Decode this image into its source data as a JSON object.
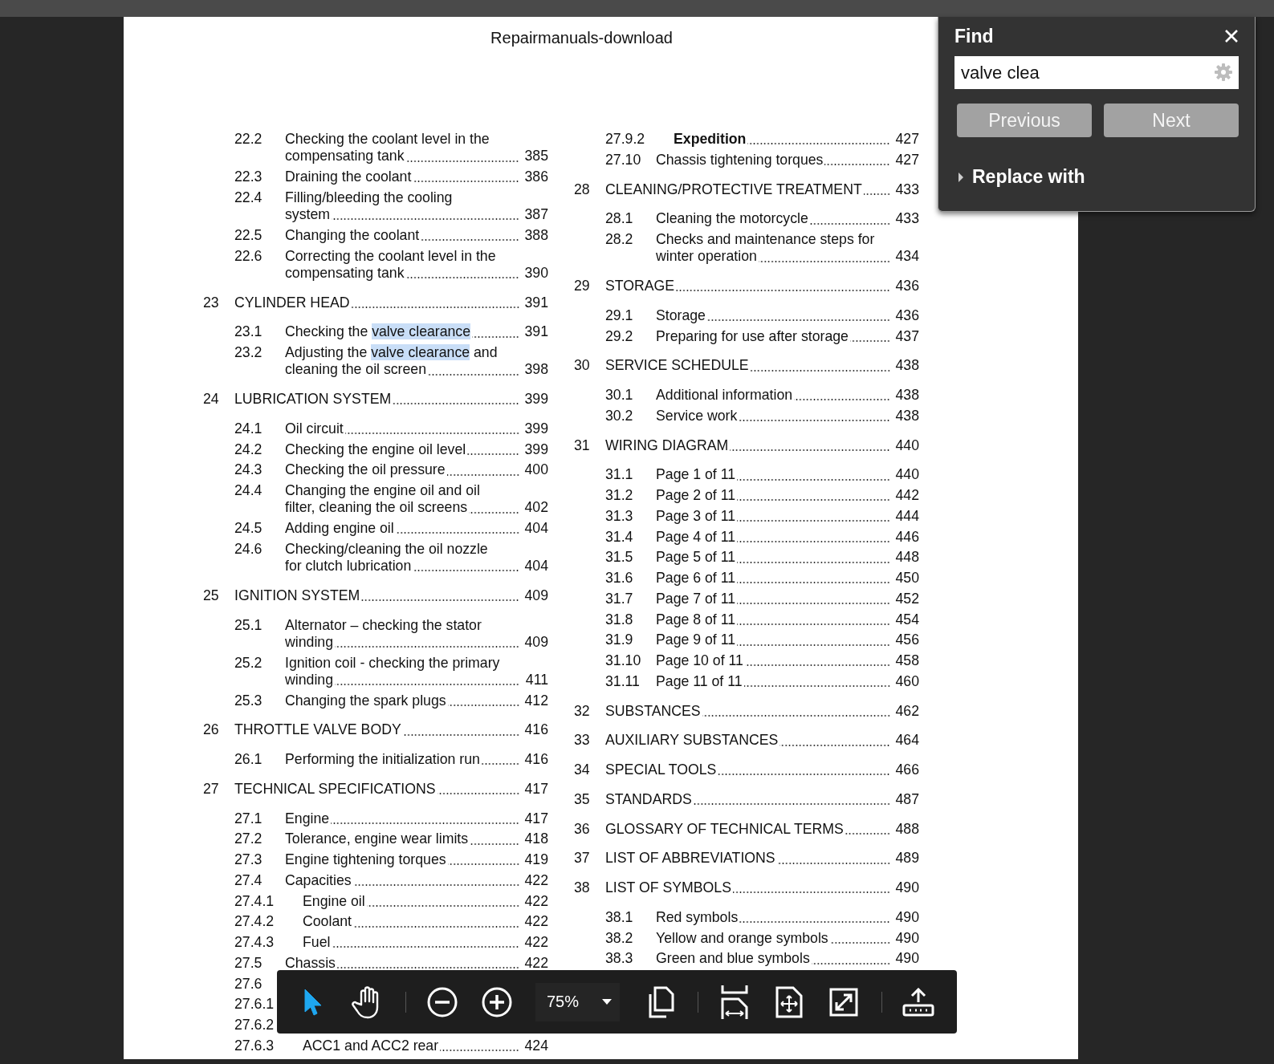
{
  "document": {
    "header": "Repairmanuals-download",
    "columns": [
      {
        "entries": [
          {
            "kind": "section",
            "number": "22.2",
            "lines": [
              "Checking the coolant level in the",
              "compensating tank"
            ],
            "page": "385"
          },
          {
            "kind": "section",
            "number": "22.3",
            "lines": [
              "Draining the coolant"
            ],
            "page": "386"
          },
          {
            "kind": "section",
            "number": "22.4",
            "lines": [
              "Filling/bleeding the cooling",
              "system"
            ],
            "page": "387"
          },
          {
            "kind": "section",
            "number": "22.5",
            "lines": [
              "Changing the coolant"
            ],
            "page": "388"
          },
          {
            "kind": "section",
            "number": "22.6",
            "lines": [
              "Correcting the coolant level in the",
              "compensating tank"
            ],
            "page": "390"
          },
          {
            "kind": "chapter",
            "number": "23",
            "lines": [
              "CYLINDER HEAD"
            ],
            "page": "391"
          },
          {
            "kind": "section",
            "number": "23.1",
            "lines": [
              {
                "segments": [
                  {
                    "text": "Checking the ",
                    "highlighted": false
                  },
                  {
                    "text": "valve clearance",
                    "highlighted": true
                  }
                ]
              }
            ],
            "page": "391"
          },
          {
            "kind": "section",
            "number": "23.2",
            "lines": [
              {
                "segments": [
                  {
                    "text": "Adjusting the ",
                    "highlighted": false
                  },
                  {
                    "text": "valve clearance",
                    "highlighted": true
                  },
                  {
                    "text": " and",
                    "highlighted": false
                  }
                ]
              },
              "cleaning the oil screen"
            ],
            "page": "398"
          },
          {
            "kind": "chapter",
            "number": "24",
            "lines": [
              "LUBRICATION SYSTEM"
            ],
            "page": "399"
          },
          {
            "kind": "section",
            "number": "24.1",
            "lines": [
              "Oil circuit"
            ],
            "page": "399"
          },
          {
            "kind": "section",
            "number": "24.2",
            "lines": [
              "Checking the engine oil level"
            ],
            "page": "399"
          },
          {
            "kind": "section",
            "number": "24.3",
            "lines": [
              "Checking the oil pressure"
            ],
            "page": "400"
          },
          {
            "kind": "section",
            "number": "24.4",
            "lines": [
              "Changing the engine oil and oil",
              "filter, cleaning the oil screens"
            ],
            "page": "402"
          },
          {
            "kind": "section",
            "number": "24.5",
            "lines": [
              "Adding engine oil"
            ],
            "page": "404"
          },
          {
            "kind": "section",
            "number": "24.6",
            "lines": [
              "Checking/cleaning the oil nozzle",
              "for clutch lubrication"
            ],
            "page": "404"
          },
          {
            "kind": "chapter",
            "number": "25",
            "lines": [
              "IGNITION SYSTEM"
            ],
            "page": "409"
          },
          {
            "kind": "section",
            "number": "25.1",
            "lines": [
              "Alternator – checking the stator",
              "winding"
            ],
            "page": "409"
          },
          {
            "kind": "section",
            "number": "25.2",
            "lines": [
              "Ignition coil - checking the primary",
              "winding"
            ],
            "page": "411"
          },
          {
            "kind": "section",
            "number": "25.3",
            "lines": [
              "Changing the spark plugs"
            ],
            "page": "412"
          },
          {
            "kind": "chapter",
            "number": "26",
            "lines": [
              "THROTTLE VALVE BODY"
            ],
            "page": "416"
          },
          {
            "kind": "section",
            "number": "26.1",
            "lines": [
              "Performing the initialization run"
            ],
            "page": "416"
          },
          {
            "kind": "chapter",
            "number": "27",
            "lines": [
              "TECHNICAL SPECIFICATIONS"
            ],
            "page": "417"
          },
          {
            "kind": "section",
            "number": "27.1",
            "lines": [
              "Engine"
            ],
            "page": "417"
          },
          {
            "kind": "section",
            "number": "27.2",
            "lines": [
              "Tolerance, engine wear limits"
            ],
            "page": "418"
          },
          {
            "kind": "section",
            "number": "27.3",
            "lines": [
              "Engine tightening torques"
            ],
            "page": "419"
          },
          {
            "kind": "section",
            "number": "27.4",
            "lines": [
              "Capacities"
            ],
            "page": "422"
          },
          {
            "kind": "subsection",
            "number": "27.4.1",
            "lines": [
              "Engine oil"
            ],
            "page": "422"
          },
          {
            "kind": "subsection",
            "number": "27.4.2",
            "lines": [
              "Coolant"
            ],
            "page": "422"
          },
          {
            "kind": "subsection",
            "number": "27.4.3",
            "lines": [
              "Fuel"
            ],
            "page": "422"
          },
          {
            "kind": "section",
            "number": "27.5",
            "lines": [
              "Chassis"
            ],
            "page": "422"
          },
          {
            "kind": "section",
            "number": "27.6"
          },
          {
            "kind": "subsection",
            "number": "27.6.1"
          },
          {
            "kind": "subsection",
            "number": "27.6.2"
          },
          {
            "kind": "subsection",
            "number": "27.6.3",
            "lines": [
              "ACC1 and ACC2 rear"
            ],
            "page": "424"
          }
        ]
      },
      {
        "entries": [
          {
            "kind": "subsection",
            "number": "27.9.2",
            "lines": [
              "Expedition"
            ],
            "page": "427",
            "bold": true
          },
          {
            "kind": "section",
            "number": "27.10",
            "lines": [
              "Chassis tightening torques"
            ],
            "page": "427"
          },
          {
            "kind": "chapter",
            "number": "28",
            "lines": [
              "CLEANING/PROTECTIVE TREATMENT"
            ],
            "page": "433"
          },
          {
            "kind": "section",
            "number": "28.1",
            "lines": [
              "Cleaning the motorcycle"
            ],
            "page": "433"
          },
          {
            "kind": "section",
            "number": "28.2",
            "lines": [
              "Checks and maintenance steps for",
              "winter operation"
            ],
            "page": "434"
          },
          {
            "kind": "chapter",
            "number": "29",
            "lines": [
              "STORAGE"
            ],
            "page": "436"
          },
          {
            "kind": "section",
            "number": "29.1",
            "lines": [
              "Storage"
            ],
            "page": "436"
          },
          {
            "kind": "section",
            "number": "29.2",
            "lines": [
              "Preparing for use after storage"
            ],
            "page": "437"
          },
          {
            "kind": "chapter",
            "number": "30",
            "lines": [
              "SERVICE SCHEDULE"
            ],
            "page": "438"
          },
          {
            "kind": "section",
            "number": "30.1",
            "lines": [
              "Additional information"
            ],
            "page": "438"
          },
          {
            "kind": "section",
            "number": "30.2",
            "lines": [
              "Service work"
            ],
            "page": "438"
          },
          {
            "kind": "chapter",
            "number": "31",
            "lines": [
              "WIRING DIAGRAM"
            ],
            "page": "440"
          },
          {
            "kind": "section",
            "number": "31.1",
            "lines": [
              "Page 1 of 11"
            ],
            "page": "440"
          },
          {
            "kind": "section",
            "number": "31.2",
            "lines": [
              "Page 2 of 11"
            ],
            "page": "442"
          },
          {
            "kind": "section",
            "number": "31.3",
            "lines": [
              "Page 3 of 11"
            ],
            "page": "444"
          },
          {
            "kind": "section",
            "number": "31.4",
            "lines": [
              "Page 4 of 11"
            ],
            "page": "446"
          },
          {
            "kind": "section",
            "number": "31.5",
            "lines": [
              "Page 5 of 11"
            ],
            "page": "448"
          },
          {
            "kind": "section",
            "number": "31.6",
            "lines": [
              "Page 6 of 11"
            ],
            "page": "450"
          },
          {
            "kind": "section",
            "number": "31.7",
            "lines": [
              "Page 7 of 11"
            ],
            "page": "452"
          },
          {
            "kind": "section",
            "number": "31.8",
            "lines": [
              "Page 8 of 11"
            ],
            "page": "454"
          },
          {
            "kind": "section",
            "number": "31.9",
            "lines": [
              "Page 9 of 11"
            ],
            "page": "456"
          },
          {
            "kind": "section",
            "number": "31.10",
            "lines": [
              "Page 10 of 11"
            ],
            "page": "458"
          },
          {
            "kind": "section",
            "number": "31.11",
            "lines": [
              "Page 11 of 11"
            ],
            "page": "460"
          },
          {
            "kind": "chapter",
            "number": "32",
            "lines": [
              "SUBSTANCES"
            ],
            "page": "462"
          },
          {
            "kind": "chapter",
            "number": "33",
            "lines": [
              "AUXILIARY SUBSTANCES"
            ],
            "page": "464"
          },
          {
            "kind": "chapter",
            "number": "34",
            "lines": [
              "SPECIAL TOOLS"
            ],
            "page": "466"
          },
          {
            "kind": "chapter",
            "number": "35",
            "lines": [
              "STANDARDS"
            ],
            "page": "487"
          },
          {
            "kind": "chapter",
            "number": "36",
            "lines": [
              "GLOSSARY OF TECHNICAL TERMS"
            ],
            "page": "488"
          },
          {
            "kind": "chapter",
            "number": "37",
            "lines": [
              "LIST OF ABBREVIATIONS"
            ],
            "page": "489"
          },
          {
            "kind": "chapter",
            "number": "38",
            "lines": [
              "LIST OF SYMBOLS"
            ],
            "page": "490"
          },
          {
            "kind": "section",
            "number": "38.1",
            "lines": [
              "Red symbols"
            ],
            "page": "490"
          },
          {
            "kind": "section",
            "number": "38.2",
            "lines": [
              "Yellow and orange symbols"
            ],
            "page": "490"
          },
          {
            "kind": "section",
            "number": "38.3",
            "lines": [
              "Green and blue symbols"
            ],
            "page": "490"
          }
        ]
      }
    ]
  },
  "find_panel": {
    "title": "Find",
    "query": "valve clea",
    "buttons": [
      {
        "label": "Previous"
      },
      {
        "label": "Next"
      }
    ],
    "replace": {
      "label": "Replace with",
      "expanded": false
    }
  },
  "toolbar": {
    "tools": [
      {
        "selected": true
      },
      {
        "selected": false
      }
    ],
    "zoom": "75%"
  }
}
